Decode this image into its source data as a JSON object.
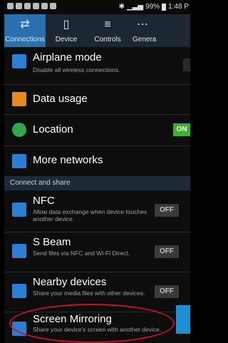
{
  "status_bar": {
    "battery": "99%",
    "time": "1:48 P"
  },
  "tabs": [
    {
      "label": "Connections",
      "icon": "⇄"
    },
    {
      "label": "Device",
      "icon": "▯"
    },
    {
      "label": "Controls",
      "icon": "≡"
    },
    {
      "label": "Genera",
      "icon": "⋯"
    }
  ],
  "items": {
    "airplane": {
      "title": "Airplane mode",
      "subtitle": "Disable all wireless connections."
    },
    "data_usage": {
      "title": "Data usage"
    },
    "location": {
      "title": "Location",
      "toggle": "ON"
    },
    "more_networks": {
      "title": "More networks"
    },
    "nfc": {
      "title": "NFC",
      "subtitle": "Allow data exchange when device touches another device.",
      "toggle": "OFF"
    },
    "sbeam": {
      "title": "S Beam",
      "subtitle": "Send files via NFC and Wi-Fi Direct.",
      "toggle": "OFF"
    },
    "nearby": {
      "title": "Nearby devices",
      "subtitle": "Share your media files with other devices.",
      "toggle": "OFF"
    },
    "mirroring": {
      "title": "Screen Mirroring",
      "subtitle": "Share your device's screen with another device."
    }
  },
  "section_header": "Connect and share",
  "colors": {
    "accent": "#2a6fb0",
    "toggle_on": "#3fae2a",
    "highlight_oval": "#c8102e"
  }
}
